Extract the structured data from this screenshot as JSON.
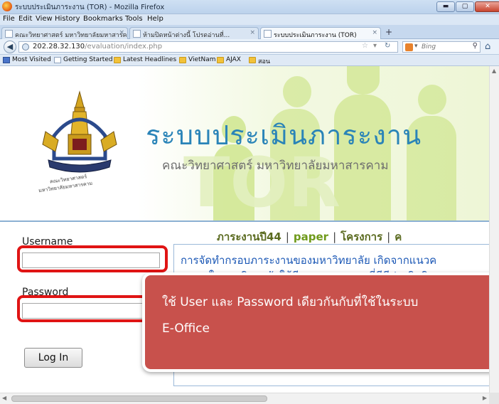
{
  "window": {
    "title": "ระบบประเมินภาระงาน (TOR) - Mozilla Firefox",
    "min_label": "▬",
    "max_label": "▢",
    "close_label": "✕"
  },
  "menu": [
    "File",
    "Edit",
    "View",
    "History",
    "Bookmarks",
    "Tools",
    "Help"
  ],
  "tabs": [
    {
      "label": "คณะวิทยาศาสตร์ มหาวิทยาลัยมหาสารคาม",
      "close": "×",
      "active": false
    },
    {
      "label": "ห้ามปิดหน้าต่างนี้ โปรดอ่านที่...",
      "close": "×",
      "active": false
    },
    {
      "label": "ระบบประเมินภาระงาน (TOR)",
      "close": "×",
      "active": true
    }
  ],
  "new_tab_label": "+",
  "nav": {
    "url_host": "202.28.32.130",
    "url_path": "/evaluation/index.php",
    "search_placeholder": "Bing"
  },
  "bookmarks": [
    {
      "label": "Most Visited",
      "icon": "blue"
    },
    {
      "label": "Getting Started",
      "icon": "page"
    },
    {
      "label": "Latest Headlines",
      "icon": "folder"
    },
    {
      "label": "VietNam",
      "icon": "folder"
    },
    {
      "label": "AJAX",
      "icon": "folder"
    },
    {
      "label": "สอน",
      "icon": "folder"
    }
  ],
  "banner": {
    "title": "ระบบประเมินภาระงาน",
    "subtitle": "คณะวิทยาศาสตร์ มหาวิทยาลัยมหาสารคาม",
    "watermark": "TOR",
    "seal_text_1": "คณะวิทยาศาสตร์",
    "seal_text_2": "มหาวิทยาลัยมหาสารคาม"
  },
  "topnav": {
    "item1": "ภาระงานปี44",
    "item2": "paper",
    "item3": "โครงการ",
    "item4": "ค",
    "sep": "|"
  },
  "login": {
    "username_label": "Username",
    "username_value": "",
    "password_label": "Password",
    "password_value": "",
    "button_label": "Log In"
  },
  "news": {
    "line1": "การจัดทำกรอบภาระงานของมหาวิทยาลัย เกิดจากแนวค",
    "line2": "ๆ ภายในมหาวิทยาลัยให้มีระบบมาตรฐานที่ดีมีประสิทธิ"
  },
  "callout": {
    "line1": "ใช้ User และ Password เดียวกันกับที่ใช้ในระบบ",
    "line2": "E-Office"
  },
  "colors": {
    "banner_title": "#2a84b8",
    "callout_bg": "#c8514c",
    "highlight_outline": "#e01414",
    "link_blue": "#1d59b6",
    "nav_green": "#5a6a1f"
  }
}
